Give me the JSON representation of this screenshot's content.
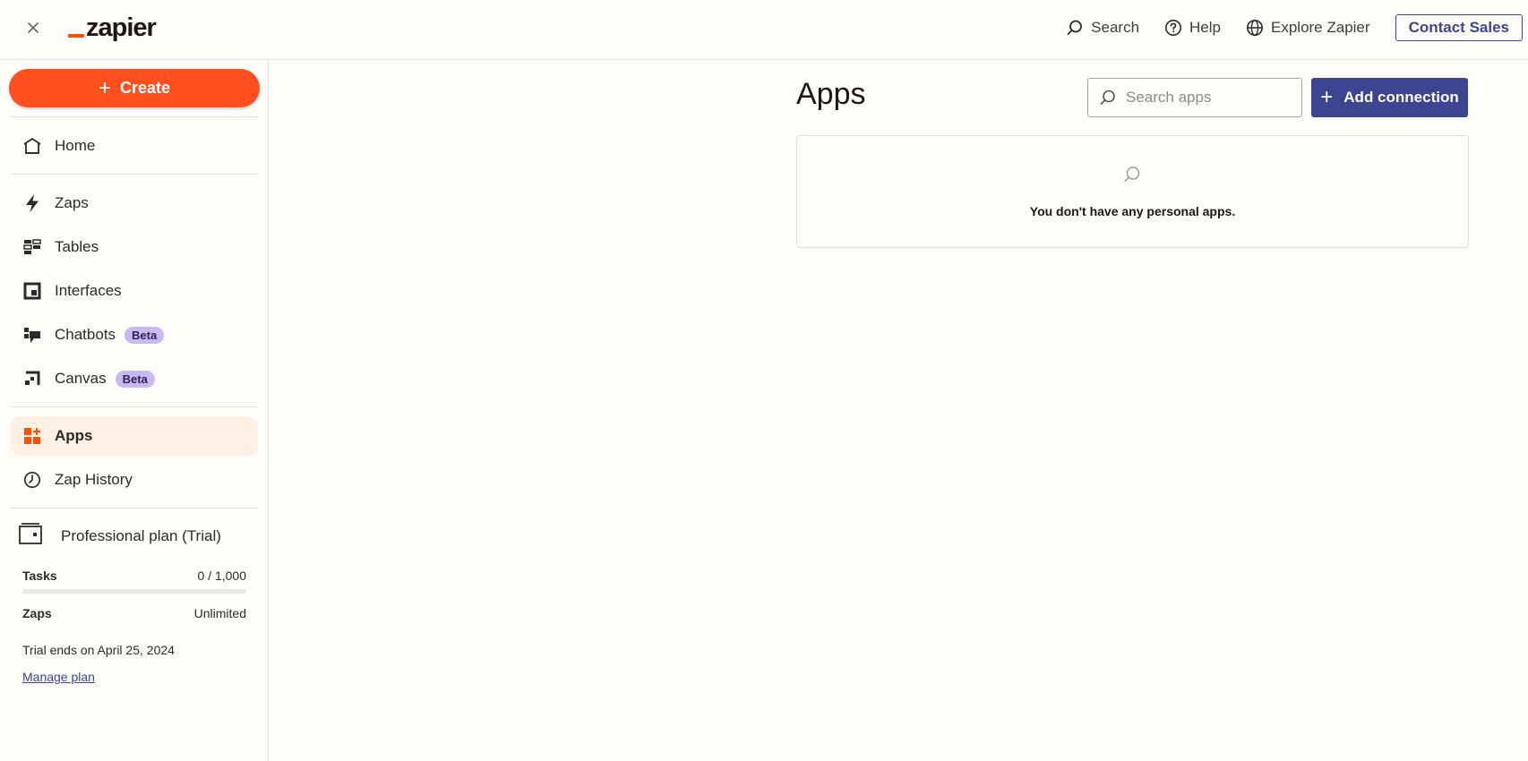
{
  "topbar": {
    "logo_text": "zapier",
    "search_label": "Search",
    "help_label": "Help",
    "explore_label": "Explore Zapier",
    "contact_label": "Contact Sales"
  },
  "sidebar": {
    "create_label": "Create",
    "items": [
      {
        "label": "Home",
        "icon": "home-icon"
      },
      {
        "label": "Zaps",
        "icon": "zap-icon"
      },
      {
        "label": "Tables",
        "icon": "tables-icon"
      },
      {
        "label": "Interfaces",
        "icon": "interfaces-icon"
      },
      {
        "label": "Chatbots",
        "icon": "chatbots-icon",
        "badge": "Beta"
      },
      {
        "label": "Canvas",
        "icon": "canvas-icon",
        "badge": "Beta"
      },
      {
        "label": "Apps",
        "icon": "apps-icon",
        "active": true
      },
      {
        "label": "Zap History",
        "icon": "history-icon"
      }
    ],
    "plan": {
      "title": "Professional plan (Trial)",
      "tasks_label": "Tasks",
      "tasks_value": "0 / 1,000",
      "tasks_progress": 0,
      "zaps_label": "Zaps",
      "zaps_value": "Unlimited",
      "trial_text": "Trial ends on April 25, 2024",
      "manage_label": "Manage plan"
    }
  },
  "main": {
    "title": "Apps",
    "search_placeholder": "Search apps",
    "add_label": "Add connection",
    "empty_text": "You don't have any personal apps."
  },
  "colors": {
    "brand_orange": "#ff4f00",
    "create_button": "#ff4f1f",
    "accent_blue": "#3d4592",
    "beta_badge": "#c8b8f5",
    "active_nav_bg": "#fff0e6"
  }
}
